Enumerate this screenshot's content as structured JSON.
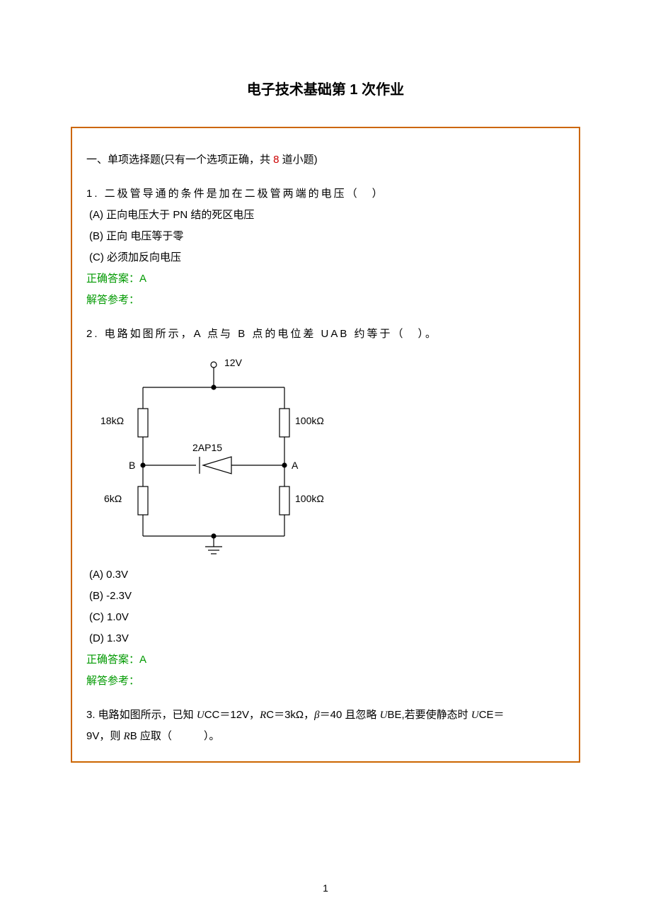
{
  "title": "电子技术基础第 1 次作业",
  "section_heading_pre": "一、单项选择题(只有一个选项正确，共 ",
  "section_heading_num": "8",
  "section_heading_post": " 道小题)",
  "q1": {
    "text": "1. 二极管导通的条件是加在二极管两端的电压（　）",
    "optA": "(A) 正向电压大于 PN  结的死区电压",
    "optB": "(B) 正向 电压等于零",
    "optC": "(C) 必须加反向电压",
    "answer": "正确答案：A",
    "explain": "解答参考："
  },
  "q2": {
    "text": "2. 电路如图所示，A 点与 B 点的电位差 UAB 约等于（　）。",
    "circuit": {
      "top_v": "12V",
      "r_left_top": "18kΩ",
      "r_right_top": "100kΩ",
      "diode": "2AP15",
      "node_b": "B",
      "node_a": "A",
      "r_left_bot": "6kΩ",
      "r_right_bot": "100kΩ"
    },
    "optA": "(A) 0.3V",
    "optB": "(B) -2.3V",
    "optC": "(C) 1.0V",
    "optD": "(D) 1.3V",
    "answer": "正确答案：A",
    "explain": "解答参考："
  },
  "q3": {
    "pre": "3.  电路如图所示，已知 ",
    "ucc": "U",
    "ucc_sub": "CC＝12V，",
    "rc": "R",
    "rc_sub": "C＝3kΩ，",
    "beta": "β",
    "beta_post": "＝40 且忽略 ",
    "ube": "U",
    "ube_sub": "BE,若要使静态时 ",
    "uce": "U",
    "uce_sub": "CE＝",
    "line2_pre": "9V，则 ",
    "rb": "R",
    "rb_sub": "B 应取（　　　）。"
  },
  "page_number": "1"
}
